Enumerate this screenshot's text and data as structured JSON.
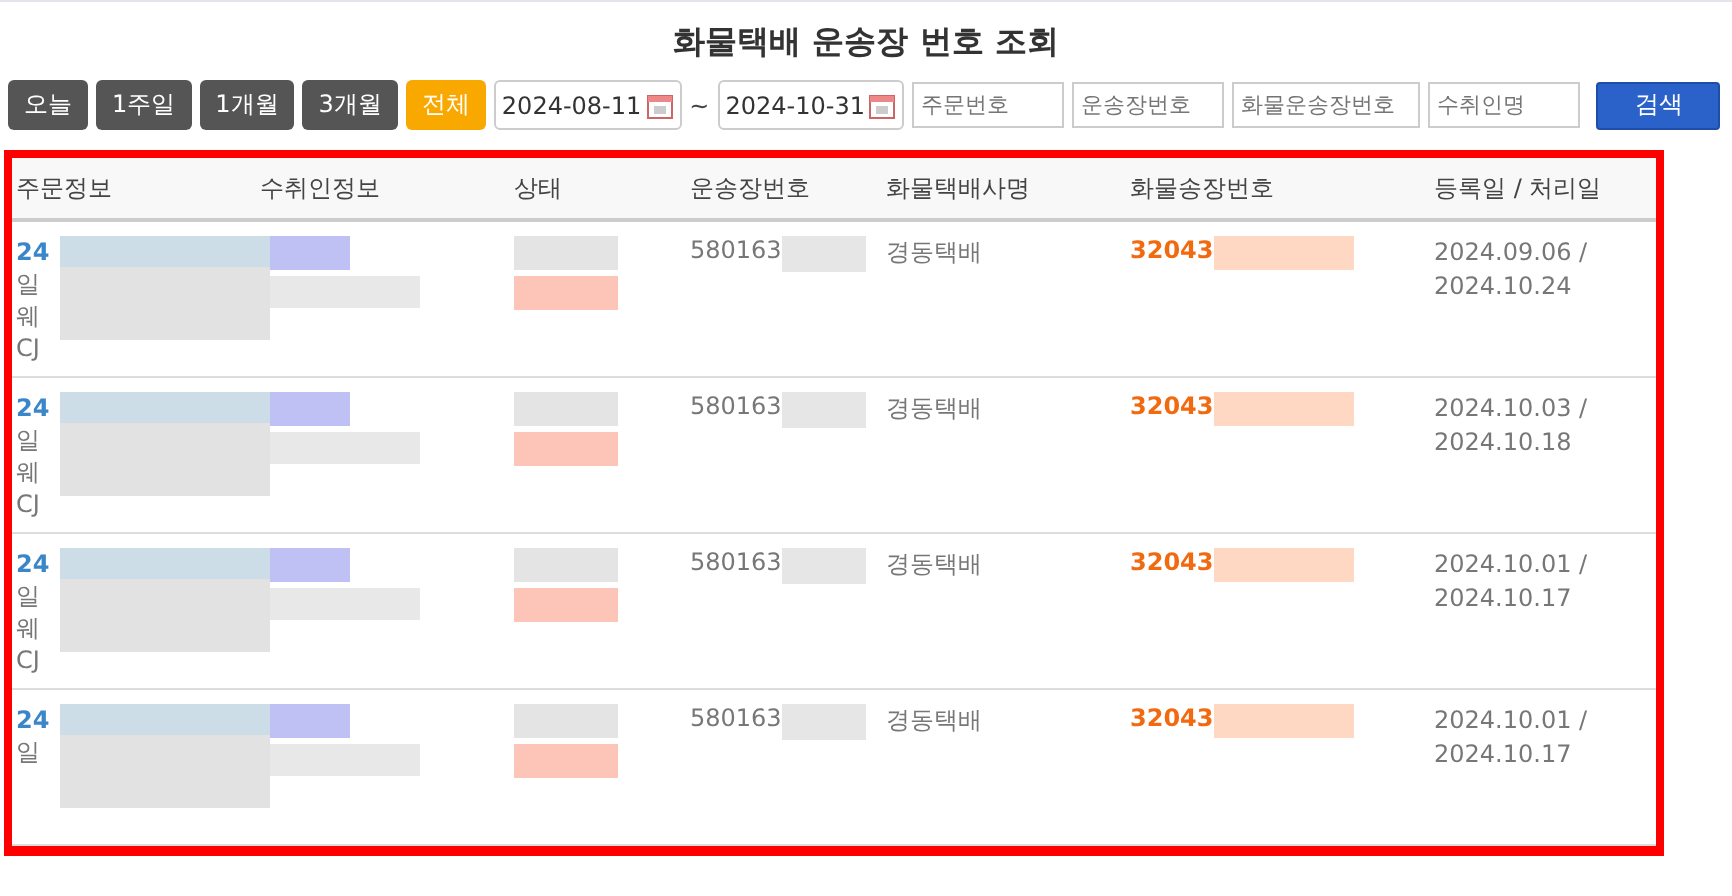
{
  "title": "화물택배 운송장 번호 조회",
  "periods": [
    {
      "label": "오늘",
      "selected": false
    },
    {
      "label": "1주일",
      "selected": false
    },
    {
      "label": "1개월",
      "selected": false
    },
    {
      "label": "3개월",
      "selected": false
    },
    {
      "label": "전체",
      "selected": true
    }
  ],
  "date_from": "2024-08-11",
  "date_sep": "~",
  "date_to": "2024-10-31",
  "filters": [
    {
      "placeholder": "주문번호"
    },
    {
      "placeholder": "운송장번호"
    },
    {
      "placeholder": "화물운송장번호"
    },
    {
      "placeholder": "수취인명"
    }
  ],
  "search_button": "검색",
  "table": {
    "columns": [
      "주문정보",
      "수취인정보",
      "상태",
      "운송장번호",
      "화물택배사명",
      "화물송장번호",
      "등록일 / 처리일"
    ],
    "rows": [
      {
        "order_lines": [
          "24",
          "일",
          "웨",
          "CJ"
        ],
        "waybill": "580163",
        "courier": "경동택배",
        "cargo_invoice": "32043",
        "dates": "2024.09.06 / 2024.10.24"
      },
      {
        "order_lines": [
          "24",
          "일",
          "웨",
          "CJ"
        ],
        "waybill": "580163",
        "courier": "경동택배",
        "cargo_invoice": "32043",
        "dates": "2024.10.03 / 2024.10.18"
      },
      {
        "order_lines": [
          "24",
          "일",
          "웨",
          "CJ"
        ],
        "waybill": "580163",
        "courier": "경동택배",
        "cargo_invoice": "32043",
        "dates": "2024.10.01 / 2024.10.17"
      },
      {
        "order_lines": [
          "24",
          "일"
        ],
        "waybill": "580163",
        "courier": "경동택배",
        "cargo_invoice": "32043",
        "dates": "2024.10.01 / 2024.10.17"
      }
    ]
  }
}
